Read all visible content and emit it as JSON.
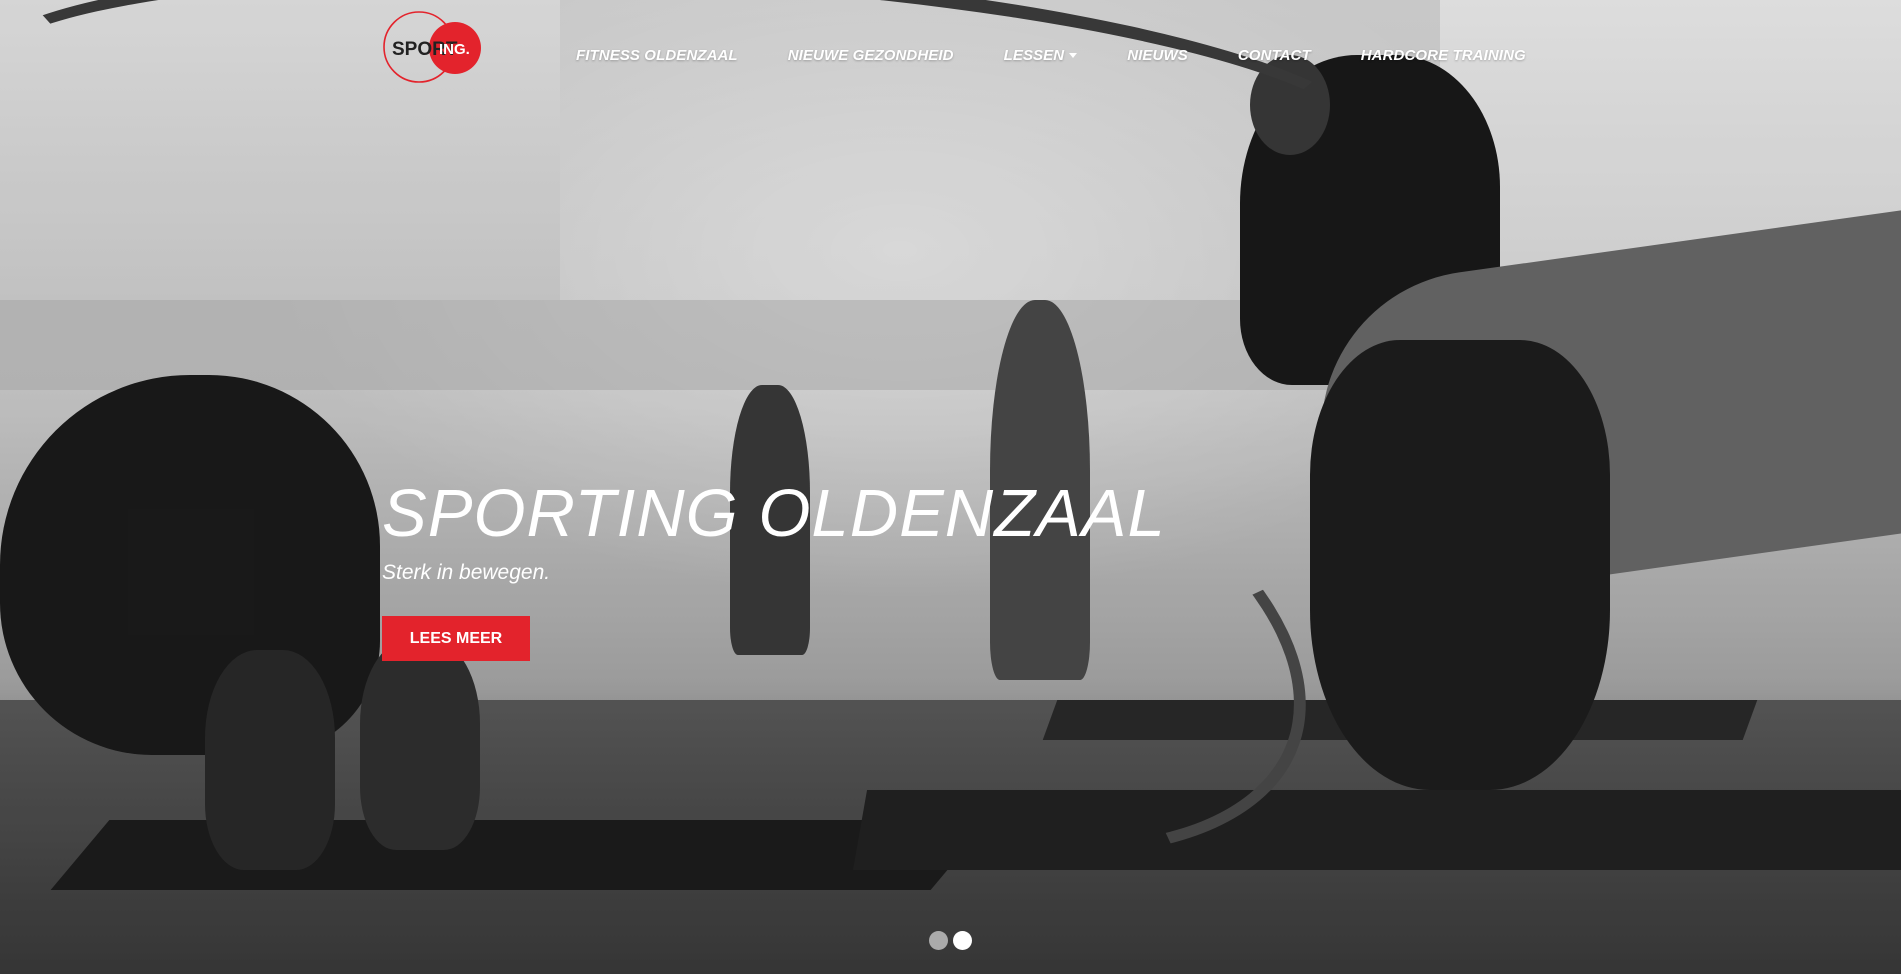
{
  "brand": {
    "logo_text_left": "SPORT",
    "logo_text_right": "ING.",
    "accent_color": "#e3232c"
  },
  "nav": {
    "items": [
      {
        "label": "FITNESS OLDENZAAL"
      },
      {
        "label": "NIEUWE GEZONDHEID"
      },
      {
        "label": "LESSEN",
        "has_dropdown": true
      },
      {
        "label": "NIEUWS"
      },
      {
        "label": "CONTACT"
      },
      {
        "label": "HARDCORE TRAINING"
      }
    ]
  },
  "hero": {
    "title": "SPORTING OLDENZAAL",
    "subtitle": "Sterk in bewegen.",
    "cta_label": "LEES MEER"
  },
  "carousel": {
    "slide_count": 2,
    "active_index": 1
  }
}
